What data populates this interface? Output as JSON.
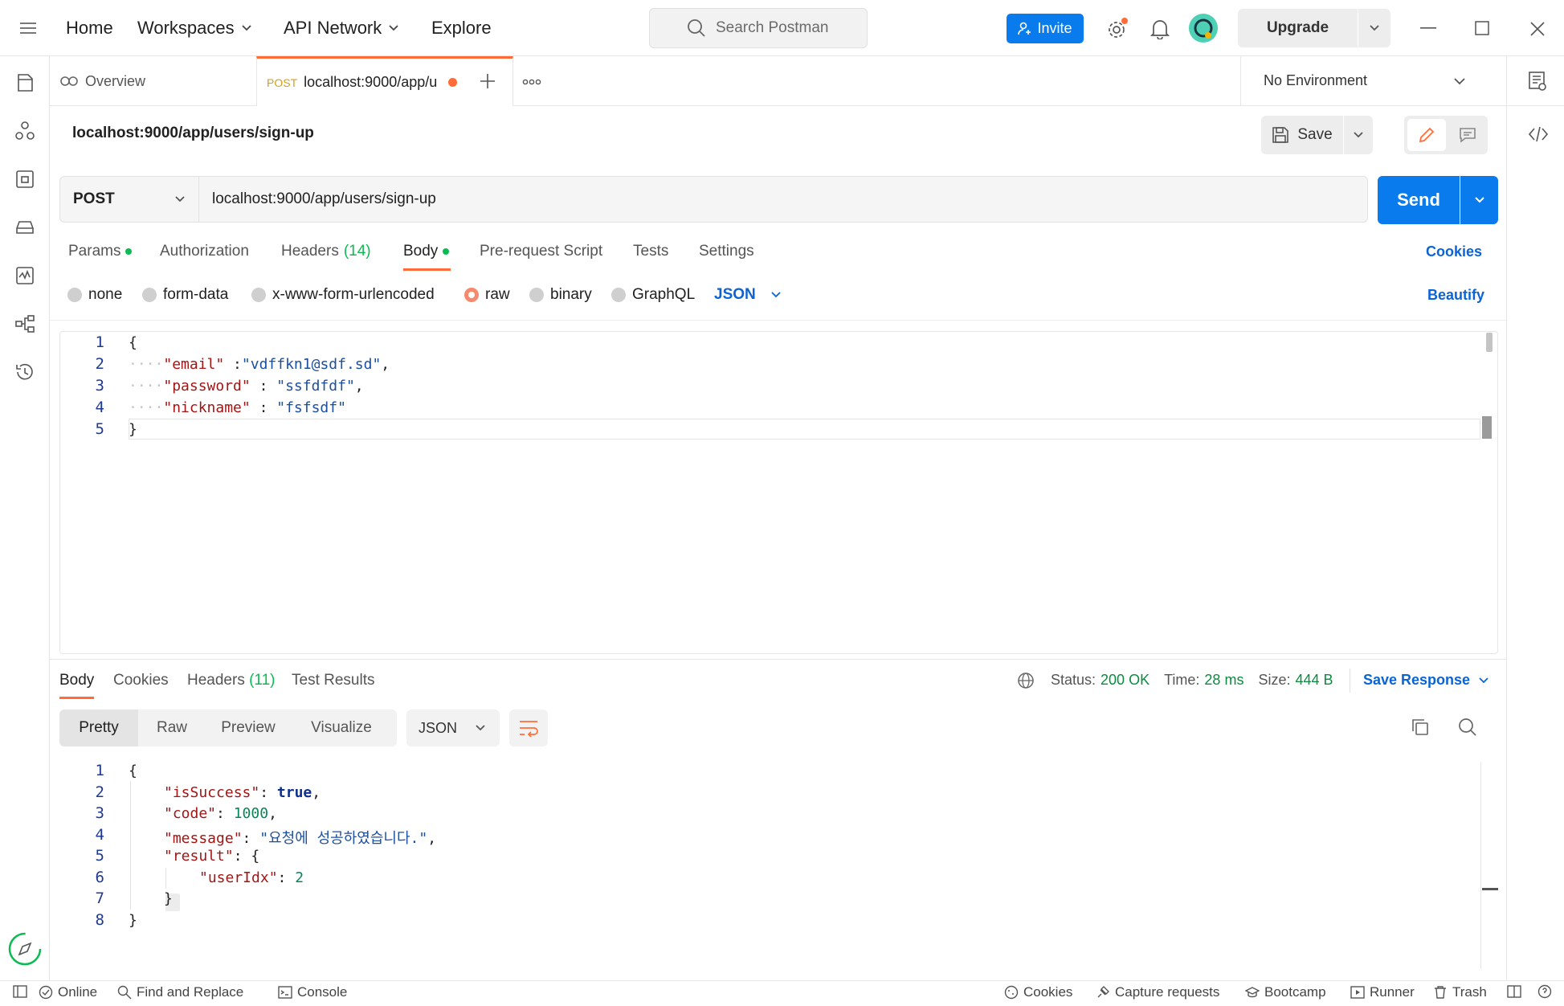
{
  "nav": {
    "home": "Home",
    "workspaces": "Workspaces",
    "api_network": "API Network",
    "explore": "Explore",
    "search_placeholder": "Search Postman",
    "invite": "Invite",
    "upgrade": "Upgrade"
  },
  "tabs": {
    "overview": "Overview",
    "active_method": "POST",
    "active_label": "localhost:9000/app/u",
    "environment": "No Environment"
  },
  "request": {
    "title": "localhost:9000/app/users/sign-up",
    "save": "Save",
    "method": "POST",
    "url": "localhost:9000/app/users/sign-up",
    "send": "Send",
    "tabs": {
      "params": "Params",
      "authorization": "Authorization",
      "headers": "Headers",
      "headers_count": "(14)",
      "body": "Body",
      "pre_request": "Pre-request Script",
      "tests": "Tests",
      "settings": "Settings"
    },
    "cookies": "Cookies",
    "body_types": {
      "none": "none",
      "form_data": "form-data",
      "urlencoded": "x-www-form-urlencoded",
      "raw": "raw",
      "binary": "binary",
      "graphql": "GraphQL",
      "format": "JSON"
    },
    "beautify": "Beautify",
    "line_numbers": [
      "1",
      "2",
      "3",
      "4",
      "5"
    ],
    "body_lines": {
      "l1": "{",
      "l2_key": "\"email\"",
      "l2_sep": " :",
      "l2_val": "\"vdffkn1@sdf.sd\"",
      "l2_end": ",",
      "l3_key": "\"password\"",
      "l3_sep": " : ",
      "l3_val": "\"ssfdfdf\"",
      "l3_end": ",",
      "l4_key": "\"nickname\"",
      "l4_sep": " : ",
      "l4_val": "\"fsfsdf\"",
      "l5": "}"
    }
  },
  "response": {
    "tabs": {
      "body": "Body",
      "cookies": "Cookies",
      "headers": "Headers",
      "headers_count": "(11)",
      "test_results": "Test Results"
    },
    "status_label": "Status:",
    "status_value": "200 OK",
    "time_label": "Time:",
    "time_value": "28 ms",
    "size_label": "Size:",
    "size_value": "444 B",
    "save_response": "Save Response",
    "views": {
      "pretty": "Pretty",
      "raw": "Raw",
      "preview": "Preview",
      "visualize": "Visualize"
    },
    "format": "JSON",
    "line_numbers": [
      "1",
      "2",
      "3",
      "4",
      "5",
      "6",
      "7",
      "8"
    ],
    "body_lines": {
      "l1": "{",
      "l2_key": "\"isSuccess\"",
      "l2_val": "true",
      "l3_key": "\"code\"",
      "l3_val": "1000",
      "l4_key": "\"message\"",
      "l4_val": "\"요청에 성공하였습니다.\"",
      "l5_key": "\"result\"",
      "l5_val": "{",
      "l6_key": "\"userIdx\"",
      "l6_val": "2",
      "l7": "}",
      "l8": "}"
    }
  },
  "statusbar": {
    "online": "Online",
    "find_replace": "Find and Replace",
    "console": "Console",
    "cookies": "Cookies",
    "capture": "Capture requests",
    "bootcamp": "Bootcamp",
    "runner": "Runner",
    "trash": "Trash"
  },
  "colors": {
    "accent": "#097bed",
    "orange": "#ff6c37",
    "success": "#0cbb52"
  }
}
